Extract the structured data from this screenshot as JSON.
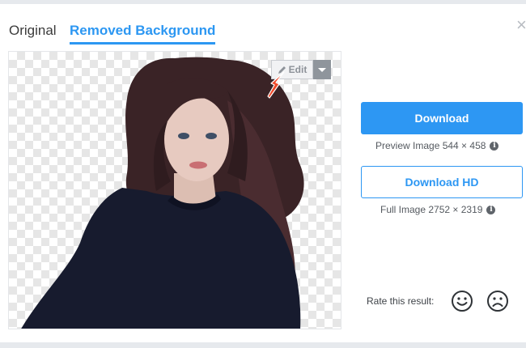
{
  "tabs": [
    {
      "label": "Original",
      "active": false
    },
    {
      "label": "Removed Background",
      "active": true
    }
  ],
  "close_icon": "close-icon",
  "preview": {
    "background": "transparency-checkerboard",
    "edit_label": "Edit",
    "edit_icon": "pencil-icon",
    "dropdown_icon": "caret-down-icon",
    "annotation_icon": "red-arrow-icon"
  },
  "download": {
    "label": "Download",
    "info": "Preview Image 544 × 458"
  },
  "download_hd": {
    "label": "Download HD",
    "info": "Full Image 2752 × 2319"
  },
  "rating": {
    "label": "Rate this result:",
    "icons": [
      "smile-icon",
      "frown-icon"
    ]
  },
  "colors": {
    "accent": "#2d97f3",
    "text": "#3b3b3b",
    "annotation": "#ef4a2b"
  }
}
